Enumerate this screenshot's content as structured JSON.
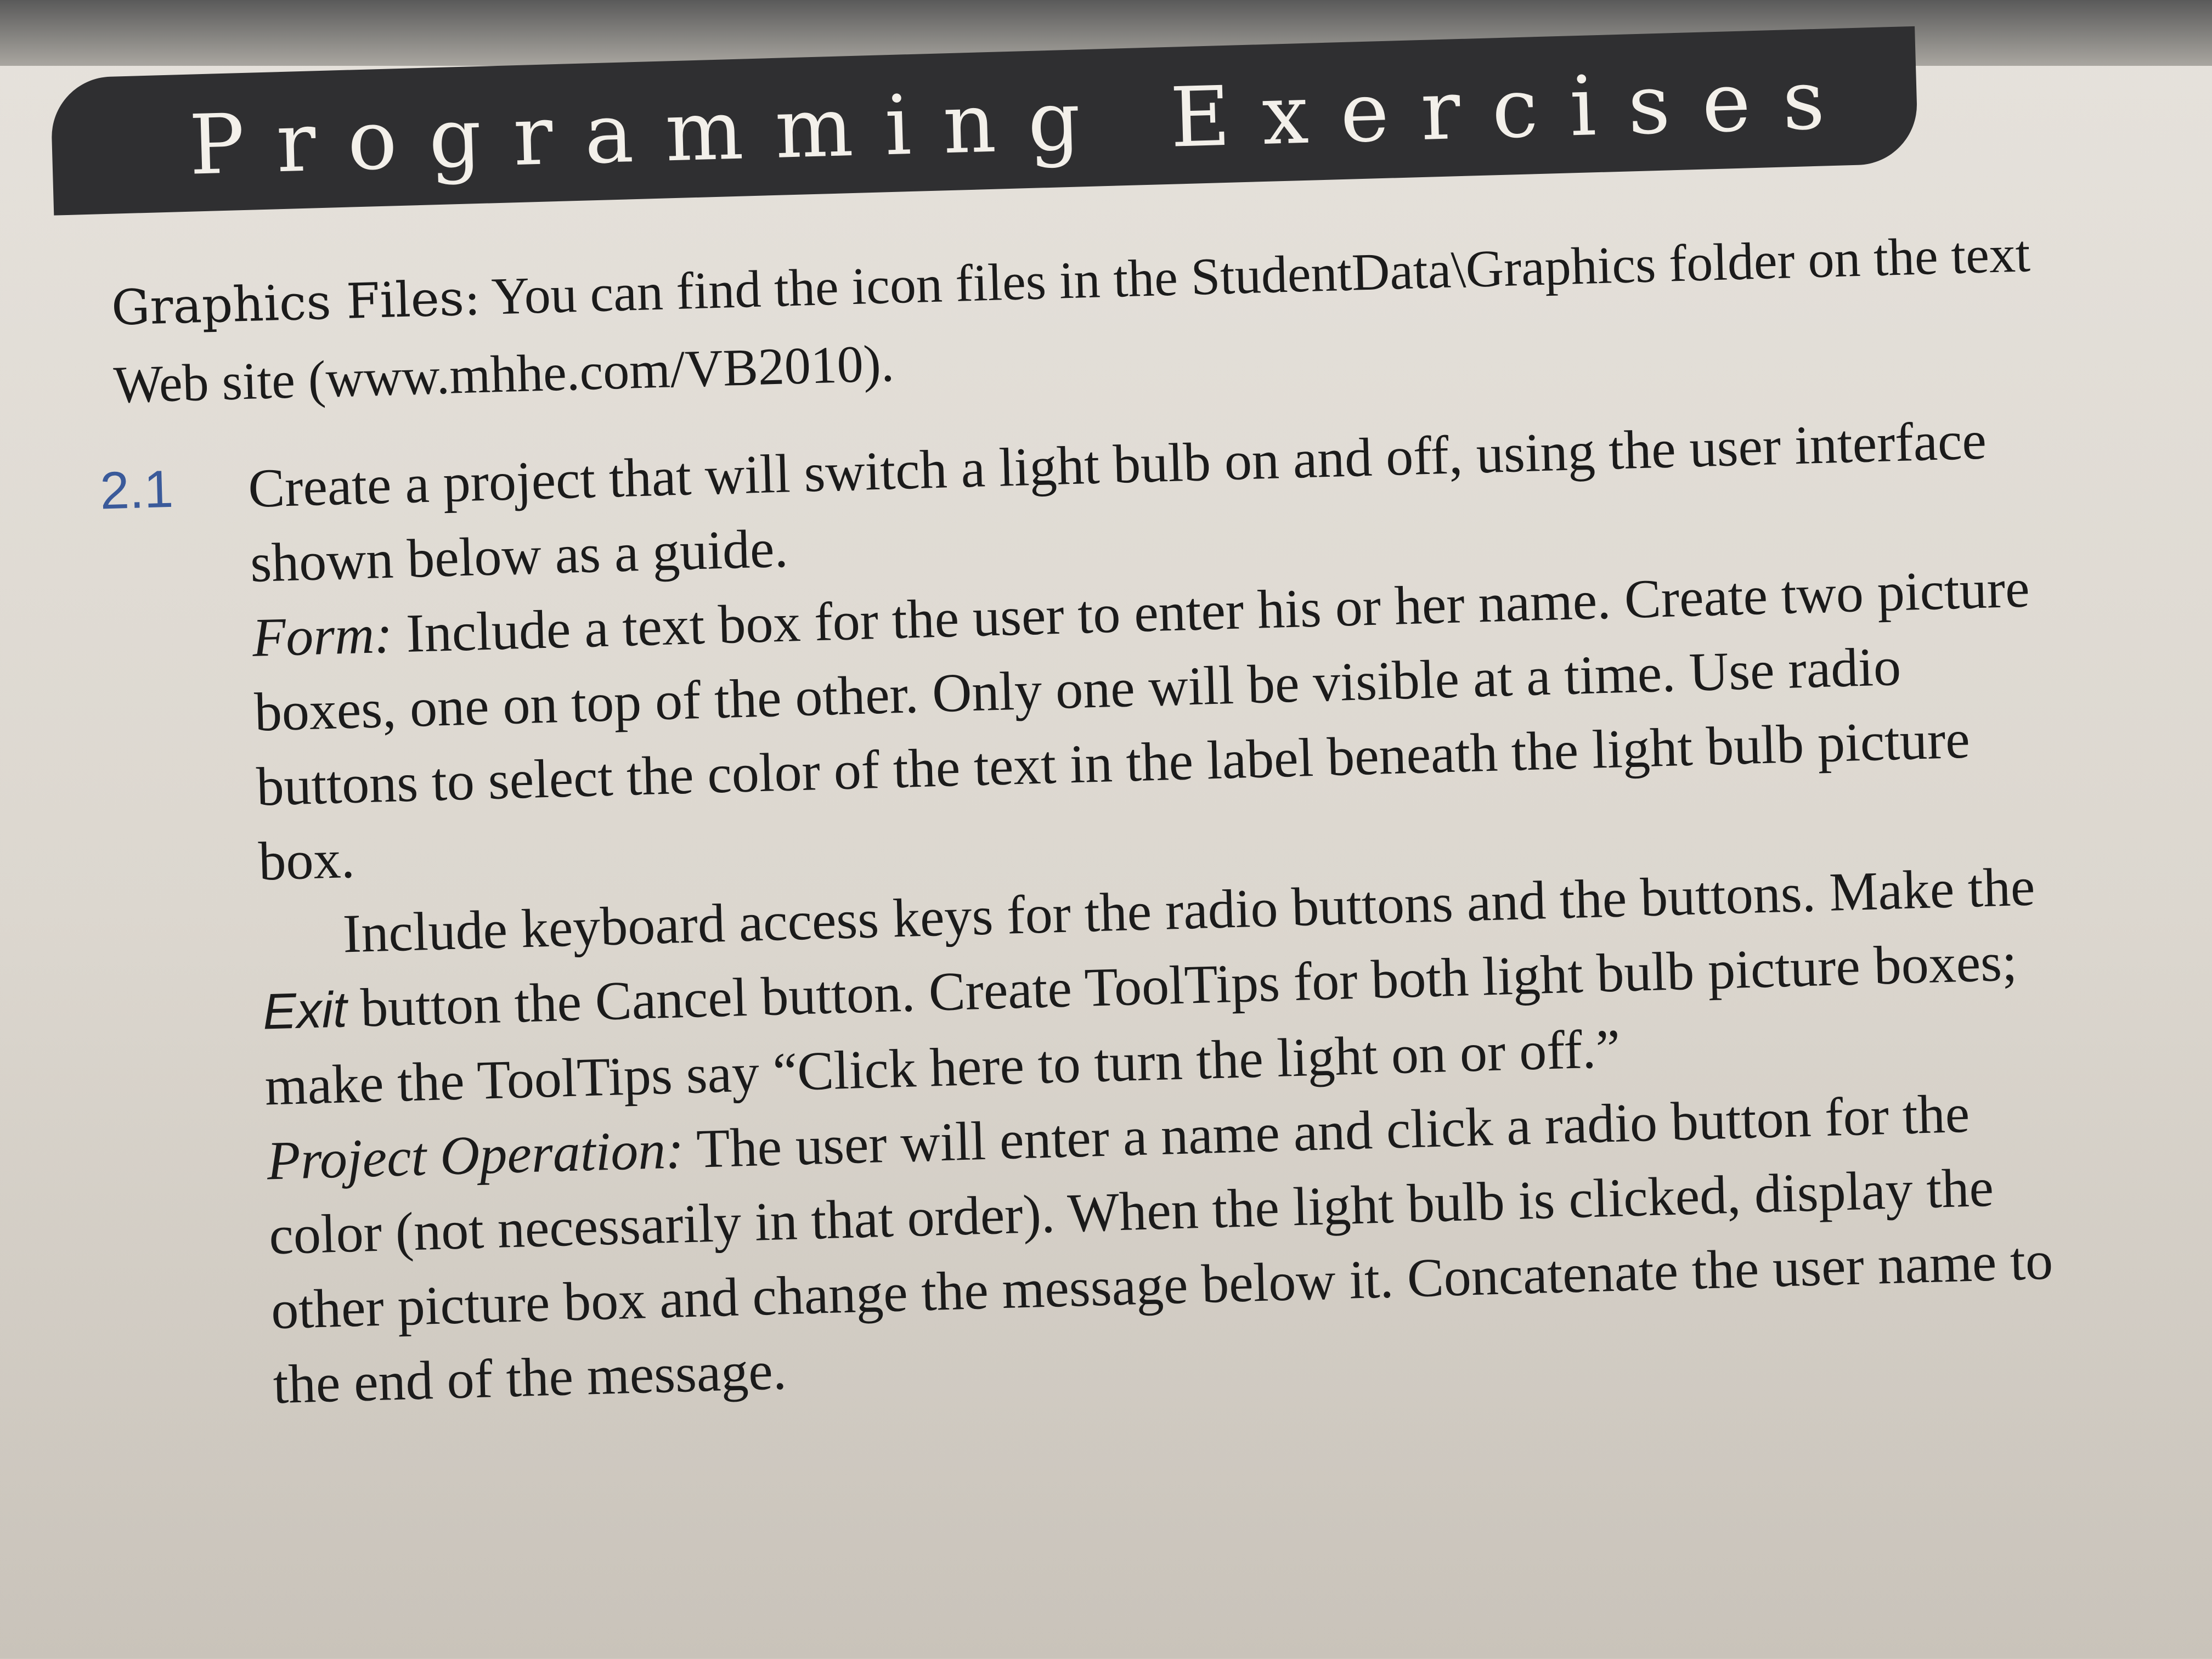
{
  "banner": {
    "title": "Programming Exercises"
  },
  "graphics_note": {
    "label": "Graphics Files:",
    "text": " You can find the icon files in the StudentData\\Graphics folder on the text Web site (www.mhhe.com/VB2010)."
  },
  "exercise": {
    "number": "2.1",
    "intro": "Create a project that will switch a light bulb on and off, using the user interface shown below as a guide.",
    "form_label": "Form:",
    "form_text": " Include a text box for the user to enter his or her name. Create two picture boxes, one on top of the other. Only one will be visible at a time. Use radio buttons to select the color of the text in the label beneath the light bulb picture box.",
    "keys_text_before": "Include keyboard access keys for the radio buttons and the buttons. Make the ",
    "exit_word": "Exit",
    "keys_text_after": " button the Cancel button. Create ToolTips for both light bulb picture boxes; make the ToolTips say “Click here to turn the light on or off.”",
    "operation_label": "Project Operation:",
    "operation_text": " The user will enter a name and click a radio button for the color (not necessarily in that order). When the light bulb is clicked, display the other picture box and change the message below it. Concatenate the user name to the end of the message."
  }
}
